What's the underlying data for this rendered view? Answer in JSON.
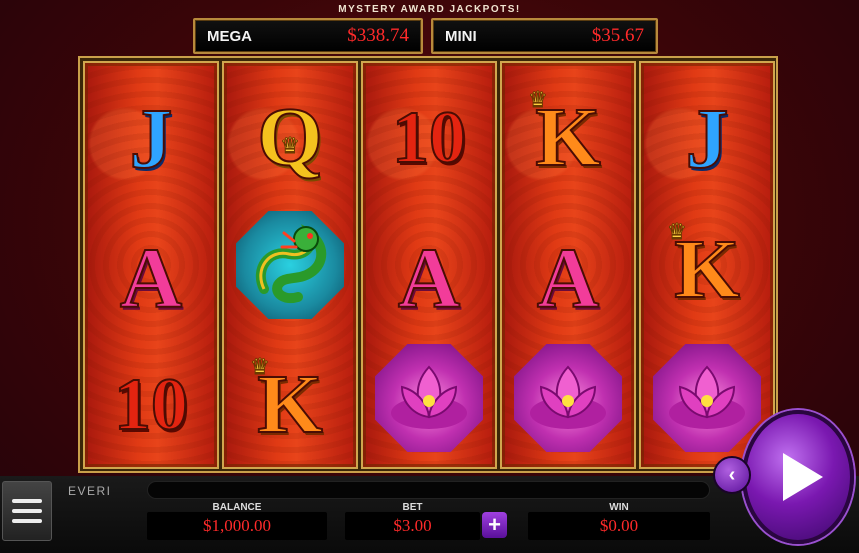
{
  "jackpots": {
    "title": "MYSTERY AWARD JACKPOTS!",
    "mega": {
      "label": "MEGA",
      "amount": "$338.74"
    },
    "mini": {
      "label": "MINI",
      "amount": "$35.67"
    }
  },
  "reels": [
    [
      "J",
      "A",
      "10"
    ],
    [
      "Q",
      "dragon",
      "K"
    ],
    [
      "10",
      "A",
      "lotus"
    ],
    [
      "K",
      "A",
      "lotus"
    ],
    [
      "J",
      "K",
      "lotus"
    ]
  ],
  "footer": {
    "brand": "EVERI",
    "balance_label": "BALANCE",
    "balance": "$1,000.00",
    "bet_label": "BET",
    "bet": "$3.00",
    "win_label": "WIN",
    "win": "$0.00"
  },
  "icons": {
    "menu": "hamburger-icon",
    "spin": "play-icon",
    "back": "chevron-left-icon",
    "bet_plus": "plus-icon"
  },
  "colors": {
    "jackpot_amount": "#ff2a2a",
    "reel_red": "#e03a14",
    "frame_gold": "#c9a04a",
    "button_purple": "#7a18b0"
  }
}
